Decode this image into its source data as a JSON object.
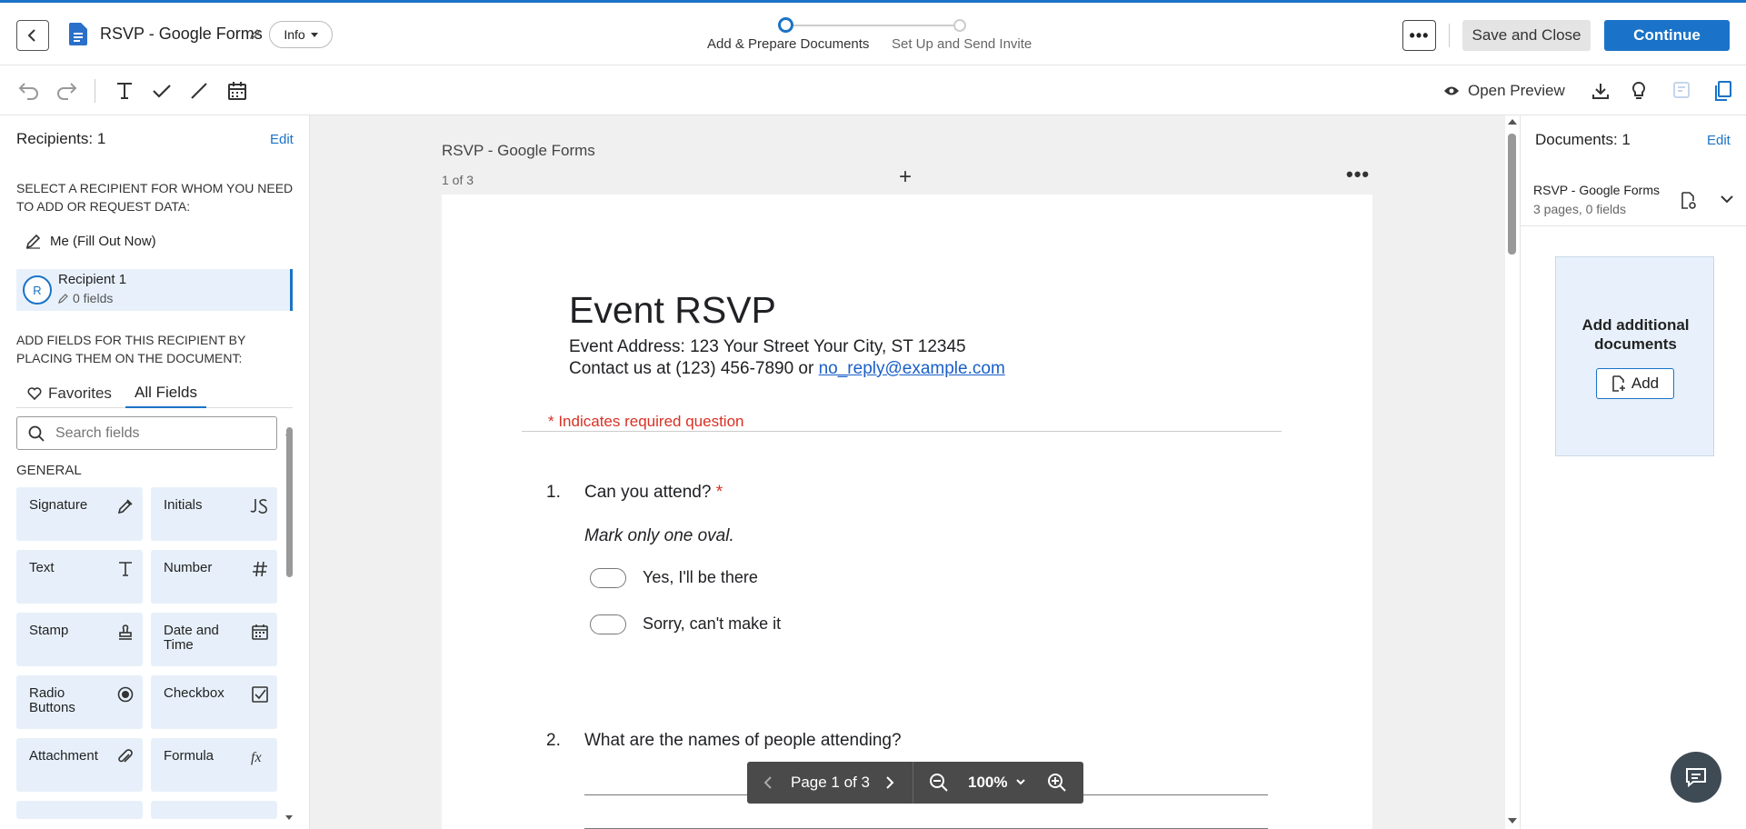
{
  "header": {
    "doc_title": "RSVP - Google Forms",
    "info_label": "Info",
    "steps": [
      "Add & Prepare Documents",
      "Set Up and Send Invite"
    ],
    "more_label": "•••",
    "save_close_label": "Save and Close",
    "continue_label": "Continue"
  },
  "toolbar": {
    "tools": [
      "undo-icon",
      "redo-icon",
      "text-tool-icon",
      "checkmark-tool-icon",
      "line-tool-icon",
      "date-tool-icon"
    ],
    "open_preview_label": "Open Preview",
    "right_icons": [
      "download-icon",
      "lightbulb-icon",
      "fields-icon",
      "documents-icon"
    ]
  },
  "left_panel": {
    "recipients_title": "Recipients: 1",
    "edit_label": "Edit",
    "select_prompt": "SELECT A RECIPIENT FOR WHOM YOU NEED TO ADD OR REQUEST DATA:",
    "me_label": "Me (Fill Out Now)",
    "recipient": {
      "initial": "R",
      "name": "Recipient 1",
      "fields": "0 fields"
    },
    "add_fields_prompt": "ADD FIELDS FOR THIS RECIPIENT BY PLACING THEM ON THE DOCUMENT:",
    "tabs": {
      "favorites": "Favorites",
      "all_fields": "All Fields"
    },
    "search_placeholder": "Search fields",
    "general_label": "GENERAL",
    "fields": [
      {
        "label": "Signature",
        "icon": "signature-icon"
      },
      {
        "label": "Initials",
        "icon": "initials-icon"
      },
      {
        "label": "Text",
        "icon": "text-icon"
      },
      {
        "label": "Number",
        "icon": "number-icon"
      },
      {
        "label": "Stamp",
        "icon": "stamp-icon"
      },
      {
        "label": "Date and Time",
        "icon": "calendar-icon"
      },
      {
        "label": "Radio Buttons",
        "icon": "radio-icon"
      },
      {
        "label": "Checkbox",
        "icon": "checkbox-icon"
      },
      {
        "label": "Attachment",
        "icon": "paperclip-icon"
      },
      {
        "label": "Formula",
        "icon": "formula-icon"
      }
    ]
  },
  "canvas": {
    "doc_title": "RSVP - Google Forms",
    "page_count": "1 of 3",
    "page": {
      "title": "Event RSVP",
      "address": "Event Address: 123 Your Street Your City, ST 12345",
      "contact_prefix": "Contact us at (123) 456-7890 or ",
      "contact_email": "no_reply@example.com",
      "required_note": "* Indicates required question",
      "q1_num": "1.",
      "q1_text": "Can you attend?",
      "q1_star": "*",
      "mark_note": "Mark only one oval.",
      "options": [
        "Yes, I'll be there",
        "Sorry, can't make it"
      ],
      "q2_num": "2.",
      "q2_text": "What are the names of people attending?"
    },
    "pagebar": {
      "page_label": "Page 1 of 3",
      "zoom": "100%"
    }
  },
  "right_panel": {
    "documents_title": "Documents: 1",
    "edit_label": "Edit",
    "doc_name": "RSVP - Google Forms",
    "doc_meta": "3 pages, 0 fields",
    "add_text": "Add additional documents",
    "add_label": "Add"
  },
  "colors": {
    "accent": "#1a73c8",
    "field_bg": "#e7f0fa",
    "required": "#d93025"
  }
}
